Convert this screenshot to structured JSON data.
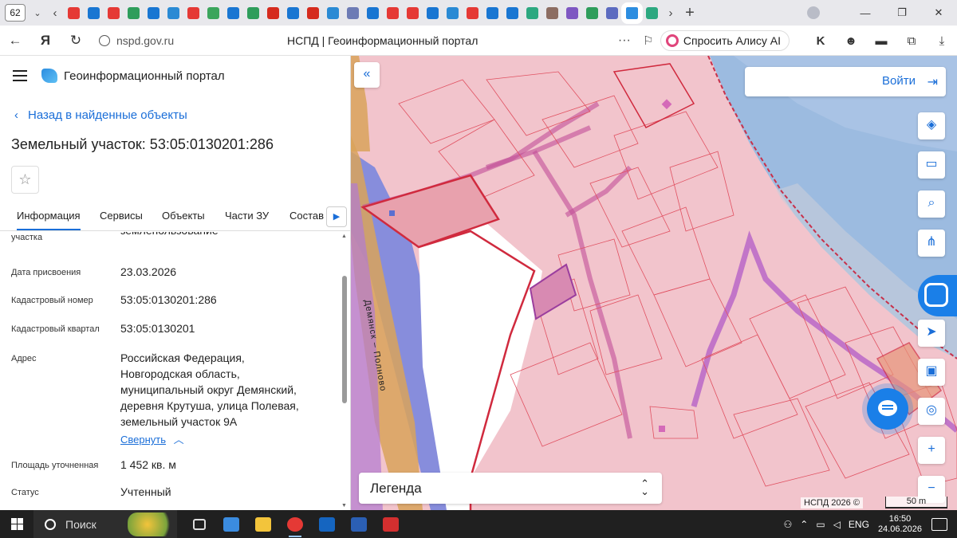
{
  "browser": {
    "tab_count": "62",
    "tab_icons": [
      {
        "name": "pdf-icon",
        "color": "#e53935"
      },
      {
        "name": "app-icon",
        "color": "#1976d2"
      },
      {
        "name": "pdf-icon",
        "color": "#e53935"
      },
      {
        "name": "doc-icon",
        "color": "#2e9d5b"
      },
      {
        "name": "mail-icon",
        "color": "#1976d2"
      },
      {
        "name": "image-icon",
        "color": "#2a8ad4"
      },
      {
        "name": "pdf-icon",
        "color": "#e53935"
      },
      {
        "name": "check-icon",
        "color": "#3ba55c"
      },
      {
        "name": "app-icon",
        "color": "#1976d2"
      },
      {
        "name": "doc-icon",
        "color": "#2e9d5b"
      },
      {
        "name": "flag-icon",
        "color": "#d52b1e"
      },
      {
        "name": "mail-icon",
        "color": "#1976d2"
      },
      {
        "name": "flag-icon",
        "color": "#d52b1e"
      },
      {
        "name": "image-icon",
        "color": "#2a8ad4"
      },
      {
        "name": "emblem-icon",
        "color": "#6d7bb5"
      },
      {
        "name": "app-icon",
        "color": "#1976d2"
      },
      {
        "name": "pdf-icon",
        "color": "#e53935"
      },
      {
        "name": "pdf-icon",
        "color": "#e53935"
      },
      {
        "name": "app-icon",
        "color": "#1976d2"
      },
      {
        "name": "image-icon",
        "color": "#2a8ad4"
      },
      {
        "name": "pdf-icon",
        "color": "#e53935"
      },
      {
        "name": "doc-icon",
        "color": "#1976d2"
      },
      {
        "name": "chat-icon",
        "color": "#1976d2"
      },
      {
        "name": "puzzle-icon",
        "color": "#2ca880"
      },
      {
        "name": "avatar-icon",
        "color": "#8c6d62"
      },
      {
        "name": "app-icon",
        "color": "#7e57c2"
      },
      {
        "name": "app-icon",
        "color": "#2e9d5b"
      },
      {
        "name": "app-icon",
        "color": "#5c6bc0"
      },
      {
        "name": "portal-icon",
        "color": "#2c8de0"
      },
      {
        "name": "puzzle-icon",
        "color": "#2ca880"
      }
    ],
    "url": "nspd.gov.ru",
    "page_title": "НСПД | Геоинформационный портал",
    "alice_label": "Спросить Алису AI"
  },
  "panel": {
    "portal_name": "Геоинформационный портал",
    "back_link": "Назад в найденные объекты",
    "object_title": "Земельный участок: 53:05:0130201:286",
    "tabs": [
      "Информация",
      "Сервисы",
      "Объекты",
      "Части ЗУ",
      "Состав"
    ],
    "clipped_row": {
      "label": "участка",
      "value": "землепользование"
    },
    "properties": [
      {
        "label": "Дата присвоения",
        "value": "23.03.2026"
      },
      {
        "label": "Кадастровый номер",
        "value": "53:05:0130201:286"
      },
      {
        "label": "Кадастровый квартал",
        "value": "53:05:0130201"
      }
    ],
    "address": {
      "label": "Адрес",
      "lines": [
        "Российская Федерация,",
        "Новгородская область,",
        "муниципальный округ Демянский,",
        "деревня Крутуша, улица Полевая,",
        "земельный участок 9А"
      ],
      "collapse_link": "Свернуть"
    },
    "area": {
      "label": "Площадь уточненная",
      "value": "1 452 кв. м"
    },
    "status": {
      "label": "Статус",
      "value": "Учтенный"
    }
  },
  "map": {
    "login_label": "Войти",
    "road_label": "Демянск – Полново",
    "legend_label": "Легенда",
    "copyright": "НСПД 2026 ©",
    "scale_label": "50 m",
    "tools": [
      "layers-icon",
      "ruler-icon",
      "search-area-icon",
      "share-icon",
      "locate-icon",
      "print-icon",
      "geo-search-icon",
      "zoom-in-icon",
      "zoom-out-icon"
    ],
    "colors": {
      "parcel_fill": "#f2c4cc",
      "parcel_stroke": "#e05060",
      "water": "#9cbbe0",
      "selected": "#9b3e9e",
      "road": "#d9a35a",
      "blue_band": "#6b7fe0"
    }
  },
  "taskbar": {
    "search_label": "Поиск",
    "language": "ENG",
    "time": "16:50",
    "date": "24.06.2026"
  }
}
